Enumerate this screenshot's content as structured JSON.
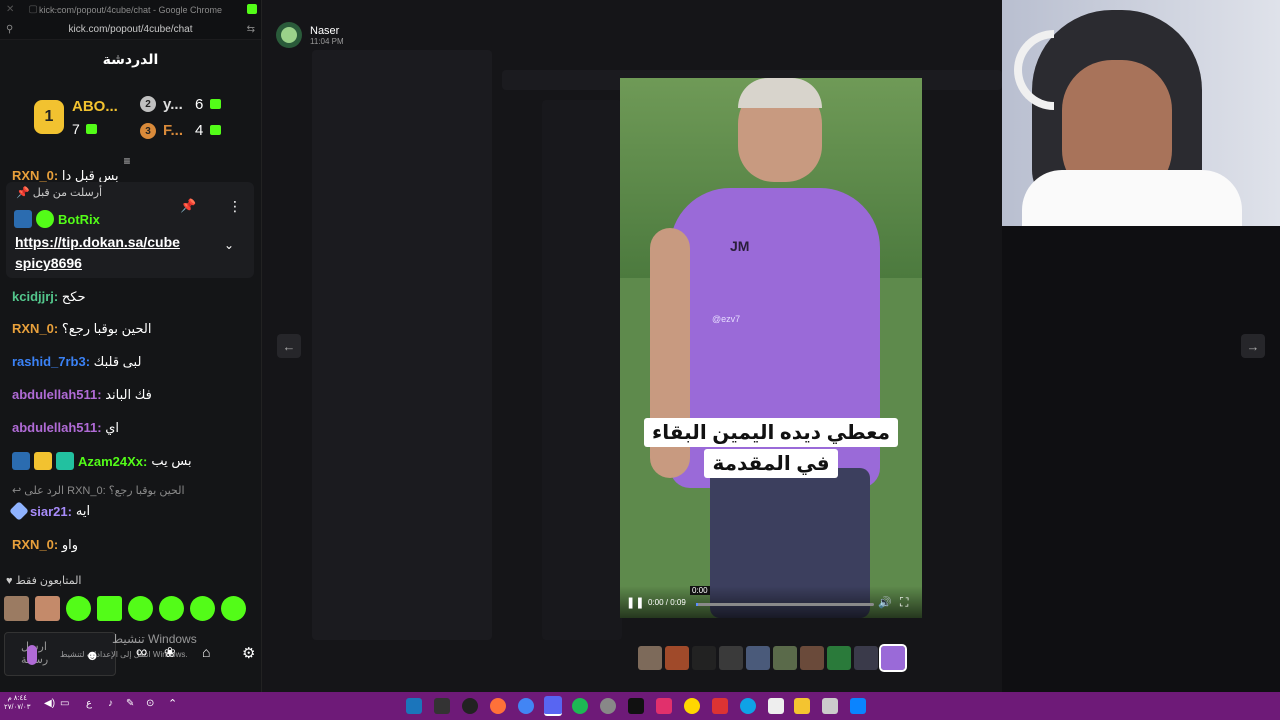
{
  "browser": {
    "title": "kick.com/popout/4cube/chat - Google Chrome",
    "url": "kick.com/popout/4cube/chat"
  },
  "chat": {
    "header": "الدردشة",
    "leaderboard": [
      {
        "rank": "1",
        "name": "ABO...",
        "count": "7"
      },
      {
        "rank": "2",
        "name": "y...",
        "count": "6"
      },
      {
        "rank": "3",
        "name": "F...",
        "count": "4"
      }
    ],
    "clipped_msg": {
      "user": "RXN_0:",
      "text": "بس قبل دا"
    },
    "pinned": {
      "label": "أرسلت من قبل",
      "user": "BotRix",
      "link_line1": "https://tip.dokan.sa/cube",
      "link_line2": "spicy8696"
    },
    "messages": [
      {
        "user": "kcidjjrj:",
        "text": "حكح",
        "color": "#53c68c"
      },
      {
        "user": "RXN_0:",
        "text": "الحين بوقبا رجع؟",
        "color": "#e8a03b"
      },
      {
        "user": "rashid_7rb3:",
        "text": "لبى قلبك",
        "color": "#3b82f6"
      },
      {
        "user": "abdulellah511:",
        "text": "فك الباند",
        "color": "#b06bd6"
      },
      {
        "user": "abdulellah511:",
        "text": "اي",
        "color": "#b06bd6"
      },
      {
        "user": "Azam24Xx:",
        "text": "بس يب",
        "color": "#53fc18"
      },
      {
        "user": "siar21:",
        "text": "ايه",
        "color": "#a78bfa"
      },
      {
        "user": "RXN_0:",
        "text": "واو",
        "color": "#e8a03b"
      }
    ],
    "reply_note": "الرد على RXN_0: الحين بوقبا رجع؟",
    "followers_only": "المتابعون فقط",
    "input_placeholder": "ارسل رسالة",
    "activation_line1": "تنشيط Windows",
    "activation_line2": "انتقل إلى الإعدادات لتنشيط Windows."
  },
  "viewer": {
    "poster": "Naser",
    "time": "11:04 PM",
    "caption_line1": "معطي ديده اليمين البقاء",
    "caption_line2": "في المقدمة",
    "shirt_text": "JM",
    "watermark": "@ezv7",
    "time_display": "0:00 / 0:09",
    "tooltip": "0:00",
    "progress": 0.01
  },
  "taskbar": {
    "clock_time": "٨:٤٤ م",
    "clock_date": "٢٧/٠٧/٠٣",
    "lang": "ع"
  },
  "colors": {
    "kick_green": "#53fc18",
    "taskbar": "#6e1a78",
    "chat_bg": "#141517"
  }
}
